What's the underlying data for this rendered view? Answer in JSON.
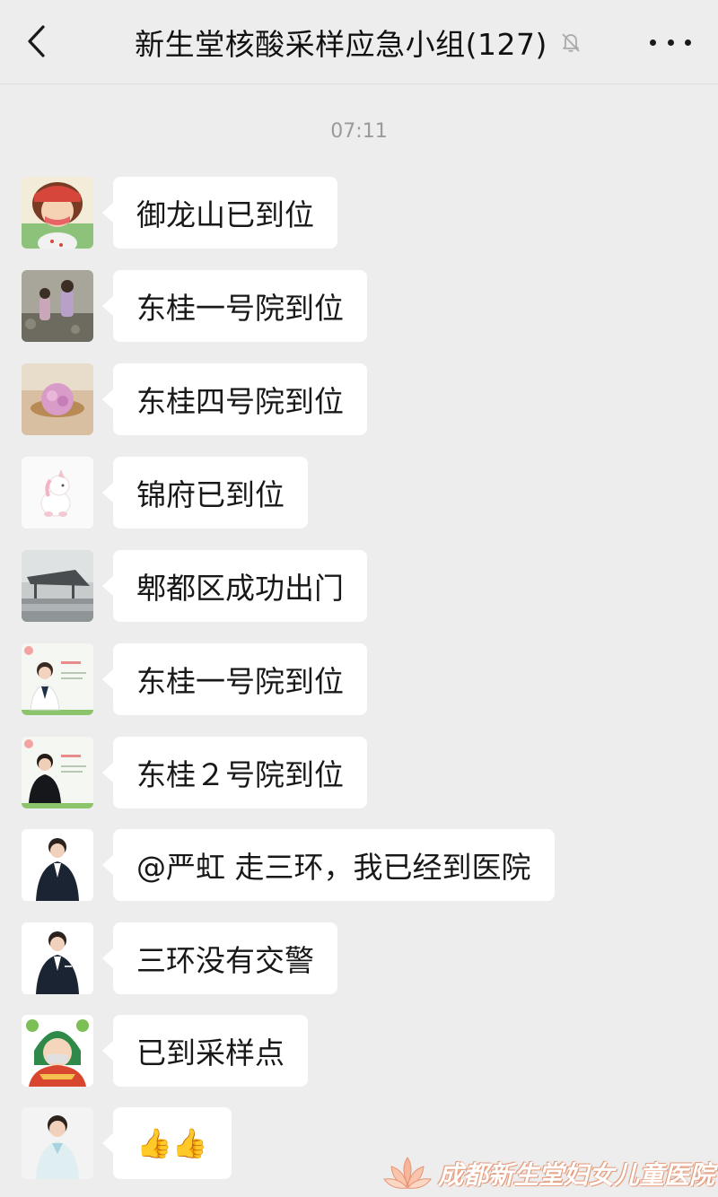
{
  "header": {
    "title": "新生堂核酸采样应急小组(127)"
  },
  "timestamp": "07:11",
  "messages": [
    {
      "text": "御龙山已到位",
      "avatar": "cartoon-girl"
    },
    {
      "text": "东桂一号院到位",
      "avatar": "children-photo"
    },
    {
      "text": "东桂四号院到位",
      "avatar": "flower-photo"
    },
    {
      "text": "锦府已到位",
      "avatar": "unicorn-toy"
    },
    {
      "text": "郫都区成功出门",
      "avatar": "building-photo"
    },
    {
      "text": "东桂一号院到位",
      "avatar": "nurse-photo-1"
    },
    {
      "text": "东桂２号院到位",
      "avatar": "nurse-photo-2"
    },
    {
      "text": "@严虹  走三环，我已经到医院",
      "avatar": "staff-photo-1"
    },
    {
      "text": "三环没有交警",
      "avatar": "staff-photo-2"
    },
    {
      "text": "已到采样点",
      "avatar": "cartoon-mask"
    },
    {
      "text": "👍👍",
      "avatar": "nurse-photo-3"
    }
  ],
  "watermark": {
    "text": "成都新生堂妇女儿童医院"
  },
  "colors": {
    "background": "#ededed",
    "bubble": "#ffffff",
    "text": "#181818",
    "timestamp": "#9a9a9a"
  }
}
